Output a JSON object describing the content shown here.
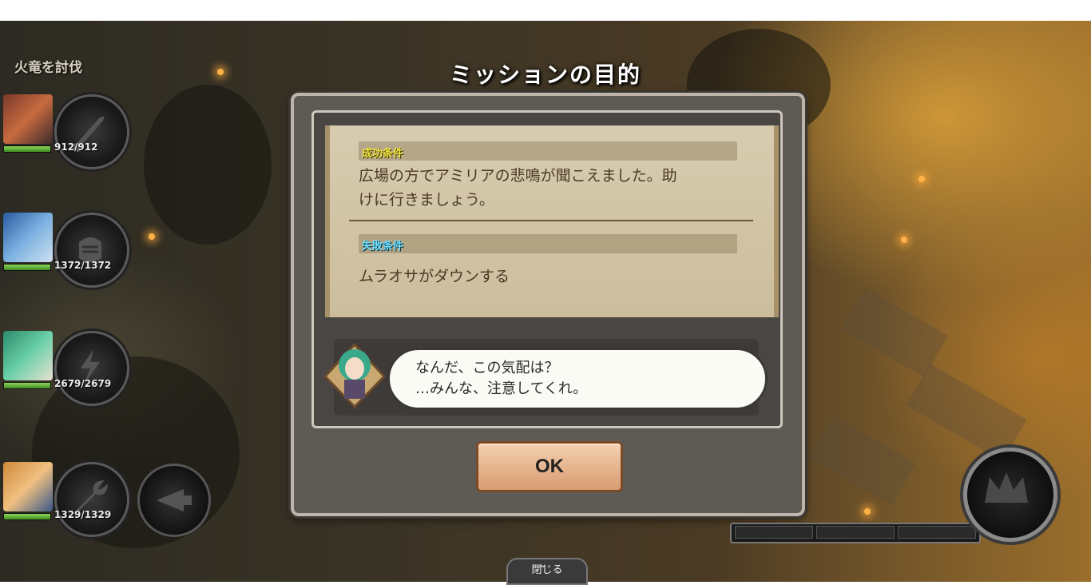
{
  "mission": {
    "name": "火竜を討伐"
  },
  "dialog": {
    "title": "ミッションの目的",
    "success": {
      "label": "成功条件",
      "lines": [
        "広場の方でアミリアの悲鳴が聞こえました。助",
        "けに行きましょう。"
      ]
    },
    "failure": {
      "label": "失敗条件",
      "text": "ムラオサがダウンする"
    },
    "speech": {
      "lines": [
        "なんだ、この気配は？",
        "…みんな、注意してくれ。"
      ]
    },
    "ok_label": "OK"
  },
  "party": [
    {
      "hp": "912/912",
      "hp_fraction": 1.0,
      "skill_icon": "sword-icon"
    },
    {
      "hp": "1372/1372",
      "hp_fraction": 1.0,
      "skill_icon": "fist-icon"
    },
    {
      "hp": "2679/2679",
      "hp_fraction": 1.0,
      "skill_icon": "lightning-icon"
    },
    {
      "hp": "1329/1329",
      "hp_fraction": 1.0,
      "skill_icon": "wrench-icon"
    }
  ],
  "close_label": "閉じる",
  "colors": {
    "success_label": "#f2e640",
    "failure_label": "#6fe0ff",
    "hp_fill": "#5fb83a",
    "ok_button": "#e3b08a"
  }
}
